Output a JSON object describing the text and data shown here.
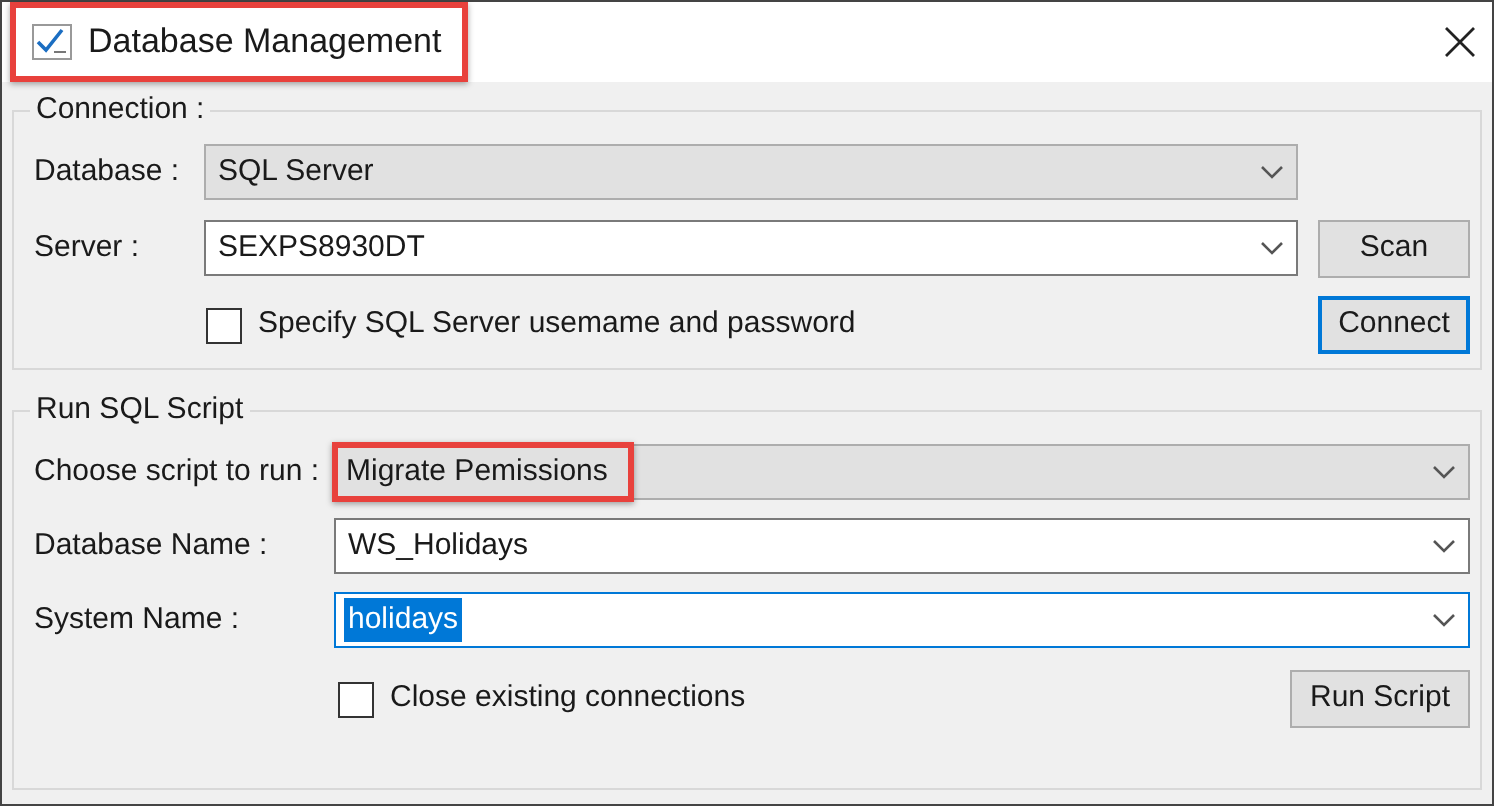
{
  "window": {
    "title": "Database Management",
    "title_highlighted": true
  },
  "connection": {
    "legend": "Connection :",
    "rows": [
      {
        "kind": "dropdown",
        "label": "Database :",
        "value": "SQL Server",
        "highlighted": false,
        "focused": false,
        "text_selected": false
      },
      {
        "kind": "combo",
        "label": "Server :",
        "value": "SEXPS8930DT",
        "highlighted": false,
        "focused": false,
        "text_selected": false
      }
    ],
    "scan_button": "Scan",
    "option": {
      "label": "Specify SQL Server usemame and password",
      "checked": false
    },
    "connect_button": {
      "label": "Connect",
      "focused": true
    }
  },
  "run_script": {
    "legend": "Run SQL Script",
    "rows": [
      {
        "kind": "dropdown",
        "label": "Choose script to run :",
        "value": "Migrate Pemissions",
        "highlighted": true,
        "focused": false,
        "text_selected": false
      },
      {
        "kind": "combo",
        "label": "Database Name :",
        "value": "WS_Holidays",
        "highlighted": false,
        "focused": false,
        "text_selected": false
      },
      {
        "kind": "combo",
        "label": "System Name :",
        "value": "holidays",
        "highlighted": false,
        "focused": true,
        "text_selected": true
      }
    ],
    "option": {
      "label": "Close existing connections",
      "checked": false
    },
    "run_button": {
      "label": "Run Script",
      "focused": false
    }
  }
}
